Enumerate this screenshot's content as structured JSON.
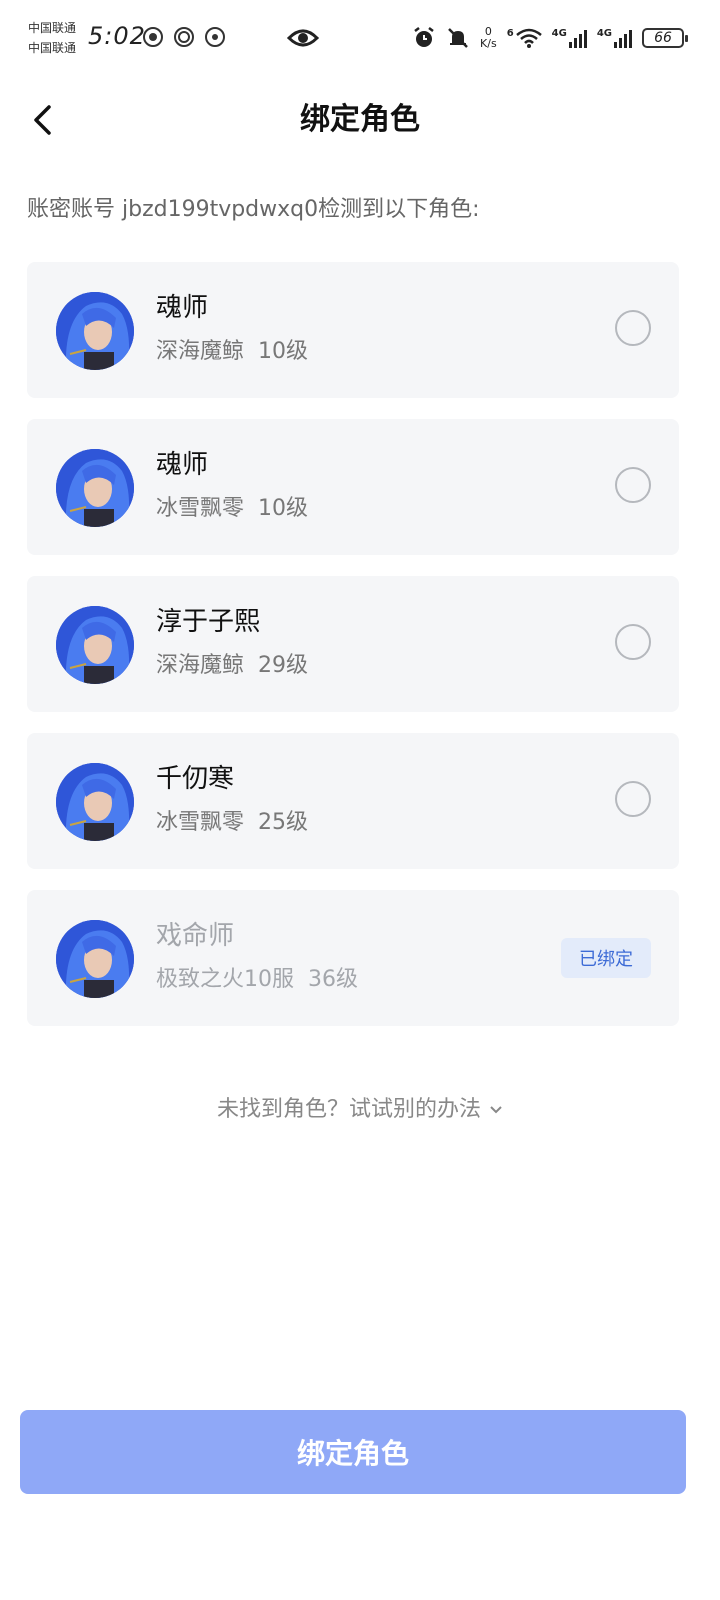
{
  "status_bar": {
    "carrier_1": "中国联通",
    "carrier_2": "中国联通",
    "time": "5:02",
    "speed_value": "0",
    "speed_unit": "K/s",
    "wifi_label": "6",
    "net_1": "4G",
    "net_2": "4G",
    "battery": "66"
  },
  "header": {
    "title": "绑定角色"
  },
  "account_line": "账密账号 jbzd199tvpdwxq0检测到以下角色:",
  "roles": [
    {
      "name": "魂师",
      "server": "深海魔鲸",
      "level": "10级"
    },
    {
      "name": "魂师",
      "server": "冰雪飘零",
      "level": "10级"
    },
    {
      "name": "淳于子熙",
      "server": "深海魔鲸",
      "level": "29级"
    },
    {
      "name": "千仞寒",
      "server": "冰雪飘零",
      "level": "25级"
    },
    {
      "name": "戏命师",
      "server": "极致之火10服",
      "level": "36级",
      "badge": "已绑定"
    }
  ],
  "alt_link": "未找到角色？试试别的办法",
  "bind_button": "绑定角色",
  "colors": {
    "button": "#8fa8f7",
    "badge_bg": "#e3ebfa",
    "badge_text": "#3d6bd6",
    "card_bg": "#f5f6f8"
  }
}
